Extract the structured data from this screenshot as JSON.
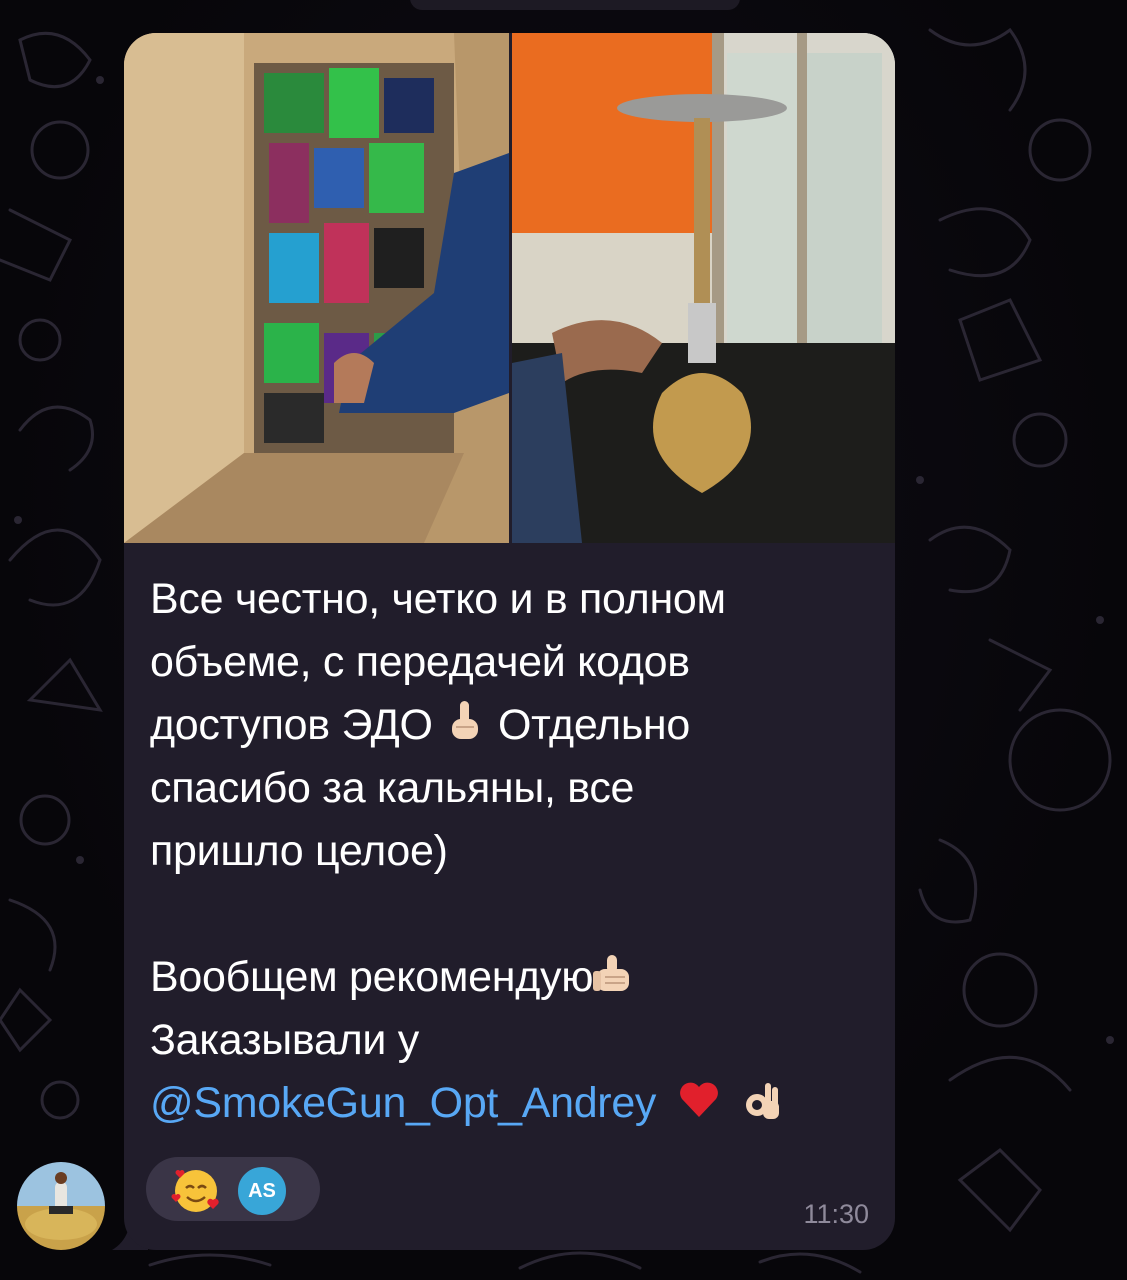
{
  "message": {
    "lines": [
      "Все честно, четко и в полном",
      "объеме, с передачей кодов",
      "доступов ЭДО",
      "Отдельно",
      "спасибо за кальяны, все",
      "пришло целое)"
    ],
    "lines2": [
      "Вообщем рекомендую",
      "Заказывали у"
    ],
    "mention": "@SmokeGun_Opt_Andrey",
    "time": "11:30"
  },
  "reactions": {
    "emoji_icon": "smiling-face-with-hearts-icon",
    "user_initials": "AS",
    "user_color": "#38a6d8"
  },
  "colors": {
    "bubble": "#211d2b",
    "mention": "#58a8f5",
    "timestamp": "#8f8a9b",
    "reaction_pill": "#3a3547"
  }
}
